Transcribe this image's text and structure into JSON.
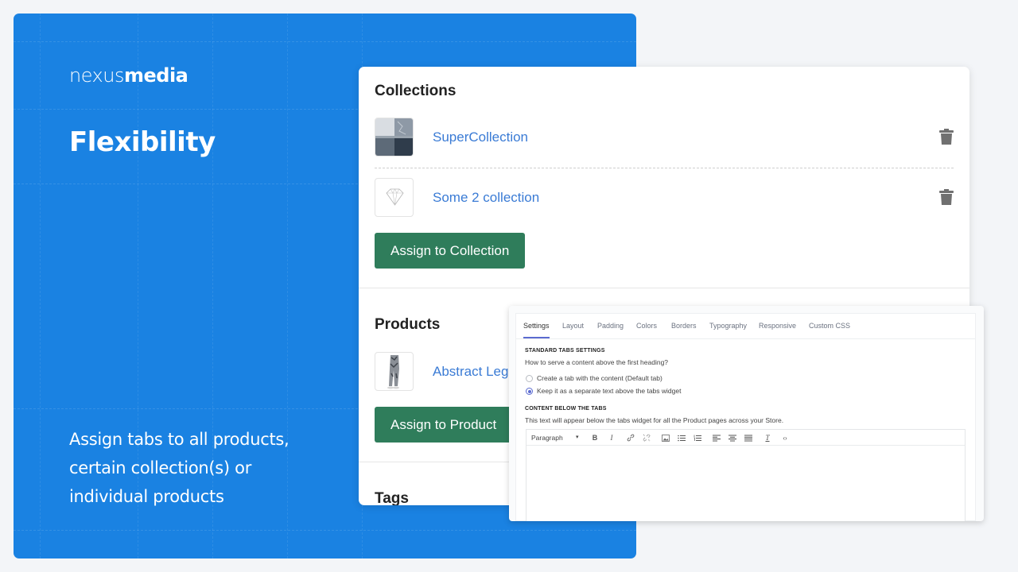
{
  "promo": {
    "logo_light": "nexus",
    "logo_bold": "media",
    "title": "Flexibility",
    "description": "Assign tabs to all products, certain collection(s) or individual products",
    "brand_color": "#1a82e2"
  },
  "collections": {
    "title": "Collections",
    "items": [
      {
        "name": "SuperCollection",
        "thumb": "seascape-thumbnail",
        "delete_icon": "trash-icon"
      },
      {
        "name": "Some 2 collection",
        "thumb": "diamond-thumbnail",
        "delete_icon": "trash-icon"
      }
    ],
    "assign_button": "Assign to Collection"
  },
  "products": {
    "title": "Products",
    "items": [
      {
        "name": "Abstract Leggings",
        "thumb": "leggings-thumbnail"
      }
    ],
    "assign_button": "Assign to Product"
  },
  "tags": {
    "title": "Tags"
  },
  "button_color": "#2f7d5b",
  "link_color": "#3a7bd5",
  "settings": {
    "tabs": [
      {
        "label": "Settings",
        "active": true
      },
      {
        "label": "Layout",
        "active": false
      },
      {
        "label": "Padding",
        "active": false
      },
      {
        "label": "Colors",
        "active": false
      },
      {
        "label": "Borders",
        "active": false
      },
      {
        "label": "Typography",
        "active": false
      },
      {
        "label": "Responsive",
        "active": false
      },
      {
        "label": "Custom CSS",
        "active": false
      }
    ],
    "standard_heading": "STANDARD TABS SETTINGS",
    "standard_question": "How to serve a content above the first heading?",
    "options": [
      {
        "label": "Create a tab with the content (Default tab)",
        "checked": false
      },
      {
        "label": "Keep it as a separate text above the tabs widget",
        "checked": true
      }
    ],
    "content_heading": "CONTENT BELOW THE TABS",
    "content_description": "This text will appear below the tabs widget for all the Product pages across your Store.",
    "editor": {
      "format_select": "Paragraph",
      "toolbar_icons": [
        "bold-icon",
        "italic-icon",
        "link-icon",
        "unlink-icon",
        "image-icon",
        "bullet-list-icon",
        "numbered-list-icon",
        "align-left-icon",
        "align-center-icon",
        "align-justify-icon",
        "clear-format-icon",
        "source-code-icon"
      ],
      "content": ""
    },
    "accent_color": "#5b6bd0"
  }
}
